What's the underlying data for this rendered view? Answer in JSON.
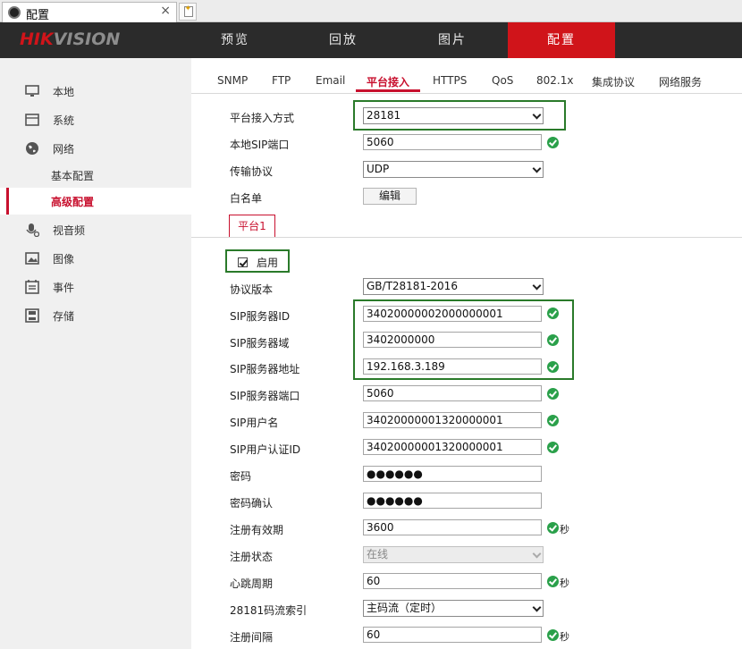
{
  "browser": {
    "tab_title": "配置",
    "close": "×"
  },
  "header": {
    "logo_a": "HIK",
    "logo_b": "VISION",
    "nav": [
      {
        "label": "预览"
      },
      {
        "label": "回放"
      },
      {
        "label": "图片"
      },
      {
        "label": "配置"
      }
    ]
  },
  "sidebar": {
    "items": [
      {
        "label": "本地"
      },
      {
        "label": "系统"
      },
      {
        "label": "网络"
      },
      {
        "label": "基本配置"
      },
      {
        "label": "高级配置"
      },
      {
        "label": "视音频"
      },
      {
        "label": "图像"
      },
      {
        "label": "事件"
      },
      {
        "label": "存储"
      }
    ]
  },
  "subtabs": [
    "SNMP",
    "FTP",
    "Email",
    "平台接入",
    "HTTPS",
    "QoS",
    "802.1x",
    "集成协议",
    "网络服务"
  ],
  "form": {
    "access_mode": {
      "label": "平台接入方式",
      "value": "28181"
    },
    "local_sip_port": {
      "label": "本地SIP端口",
      "value": "5060"
    },
    "transport": {
      "label": "传输协议",
      "value": "UDP"
    },
    "whitelist": {
      "label": "白名单",
      "button": "编辑"
    }
  },
  "platform_tab": "平台1",
  "enable_label": "启用",
  "fields": {
    "protocol_version": {
      "label": "协议版本",
      "value": "GB/T28181-2016"
    },
    "sip_server_id": {
      "label": "SIP服务器ID",
      "value": "34020000002000000001"
    },
    "sip_server_domain": {
      "label": "SIP服务器域",
      "value": "3402000000"
    },
    "sip_server_addr": {
      "label": "SIP服务器地址",
      "value": "192.168.3.189"
    },
    "sip_server_port": {
      "label": "SIP服务器端口",
      "value": "5060"
    },
    "sip_username": {
      "label": "SIP用户名",
      "value": "34020000001320000001"
    },
    "sip_auth_id": {
      "label": "SIP用户认证ID",
      "value": "34020000001320000001"
    },
    "password": {
      "label": "密码",
      "value": "●●●●●●"
    },
    "password_confirm": {
      "label": "密码确认",
      "value": "●●●●●●"
    },
    "reg_validity": {
      "label": "注册有效期",
      "value": "3600",
      "unit": "秒"
    },
    "reg_status": {
      "label": "注册状态",
      "value": "在线"
    },
    "heartbeat": {
      "label": "心跳周期",
      "value": "60",
      "unit": "秒"
    },
    "stream_index": {
      "label": "28181码流索引",
      "value": "主码流（定时）"
    },
    "reg_interval": {
      "label": "注册间隔",
      "value": "60",
      "unit": "秒"
    }
  }
}
